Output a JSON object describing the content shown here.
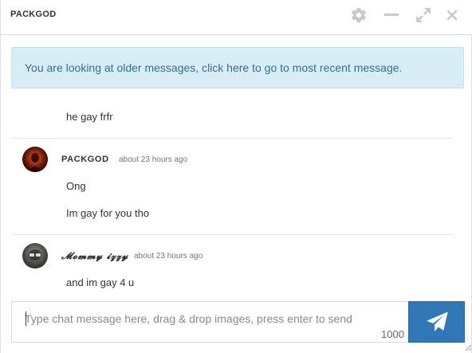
{
  "header": {
    "title": "PACKGOD",
    "icons": [
      "gear-icon",
      "minimize-icon",
      "expand-icon",
      "close-icon"
    ]
  },
  "banner": {
    "text": "You are looking at older messages, click here to go to most recent message."
  },
  "messages": [
    {
      "text": "he gay frfr"
    },
    {
      "username": "PACKGOD",
      "time": "about 23 hours ago",
      "lines": [
        "Ong",
        "Im gay for you tho"
      ]
    },
    {
      "username": "𝓜𝓸𝓶𝓶𝔂 𝓲𝔃𝔃𝔂",
      "time": "about 23 hours ago",
      "lines": [
        "and im gay 4 u"
      ]
    }
  ],
  "composer": {
    "placeholder": "Type chat message here, drag & drop images, press enter to send",
    "char_count": "1000",
    "send_icon": "paper-plane-icon"
  },
  "colors": {
    "banner_bg": "#d9edf7",
    "banner_text": "#31708f",
    "send_button": "#2f77b6"
  }
}
